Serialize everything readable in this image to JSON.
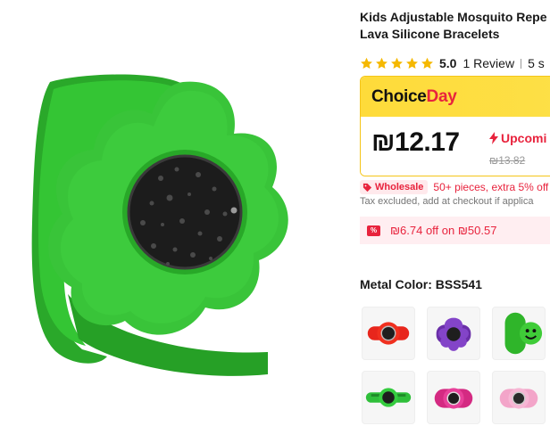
{
  "product": {
    "title_line1": "Kids Adjustable Mosquito Repe",
    "title_line2": "Lava Silicone Bracelets",
    "rating_score": "5.0",
    "review_count": "1 Review",
    "sold": "5 s"
  },
  "choice": {
    "logo_part1": "Choice",
    "logo_part2": "Day",
    "price": "₪12.17",
    "upcoming_label": "Upcomi",
    "original_price": "₪13.82"
  },
  "wholesale": {
    "badge": "Wholesale",
    "text": "50+ pieces, extra 5% off",
    "tax_note": "Tax excluded, add at checkout if applica"
  },
  "coupon": {
    "icon_text": "%",
    "text": "₪6.74 off on ₪50.57"
  },
  "variant": {
    "label": "Metal Color: BSS541",
    "options": [
      {
        "name": "red-flower",
        "color": "#e8261c"
      },
      {
        "name": "purple-flower",
        "color": "#7b3fb8"
      },
      {
        "name": "green-smiley",
        "color": "#2fb52a"
      },
      {
        "name": "green-band",
        "color": "#2fbf3a"
      },
      {
        "name": "pink-band",
        "color": "#e0338c"
      },
      {
        "name": "light-pink-band",
        "color": "#f3a5c9"
      }
    ]
  },
  "colors": {
    "accent_red": "#e8233d",
    "choice_yellow": "#fedb3a",
    "star_gold": "#f5b800",
    "main_green": "#2db52d"
  }
}
